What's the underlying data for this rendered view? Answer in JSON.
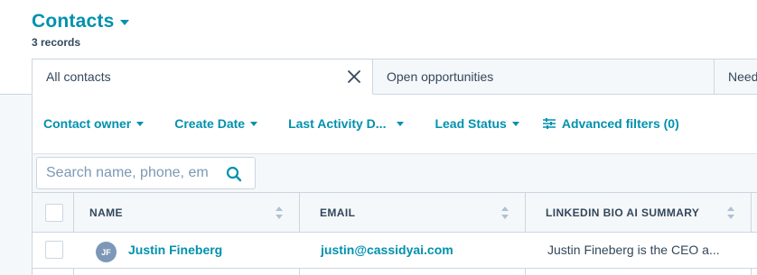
{
  "header": {
    "title": "Contacts",
    "record_count": "3 records"
  },
  "tabs": [
    {
      "label": "All contacts",
      "active": true
    },
    {
      "label": "Open opportunities",
      "active": false
    },
    {
      "label": "Need",
      "active": false
    }
  ],
  "filters": {
    "contact_owner": "Contact owner",
    "create_date": "Create Date",
    "last_activity": "Last Activity D...",
    "lead_status": "Lead Status",
    "advanced": "Advanced filters (0)"
  },
  "search": {
    "placeholder": "Search name, phone, em"
  },
  "table": {
    "columns": [
      "NAME",
      "EMAIL",
      "LINKEDIN BIO AI SUMMARY"
    ],
    "rows": [
      {
        "initials": "JF",
        "name": "Justin Fineberg",
        "email": "justin@cassidyai.com",
        "summary": "Justin Fineberg is the CEO a..."
      }
    ]
  },
  "colors": {
    "accent": "#0091ae",
    "text": "#33475b",
    "border": "#cbd6e2",
    "band": "#f5f8fa",
    "avatar": "#7c98b6"
  }
}
